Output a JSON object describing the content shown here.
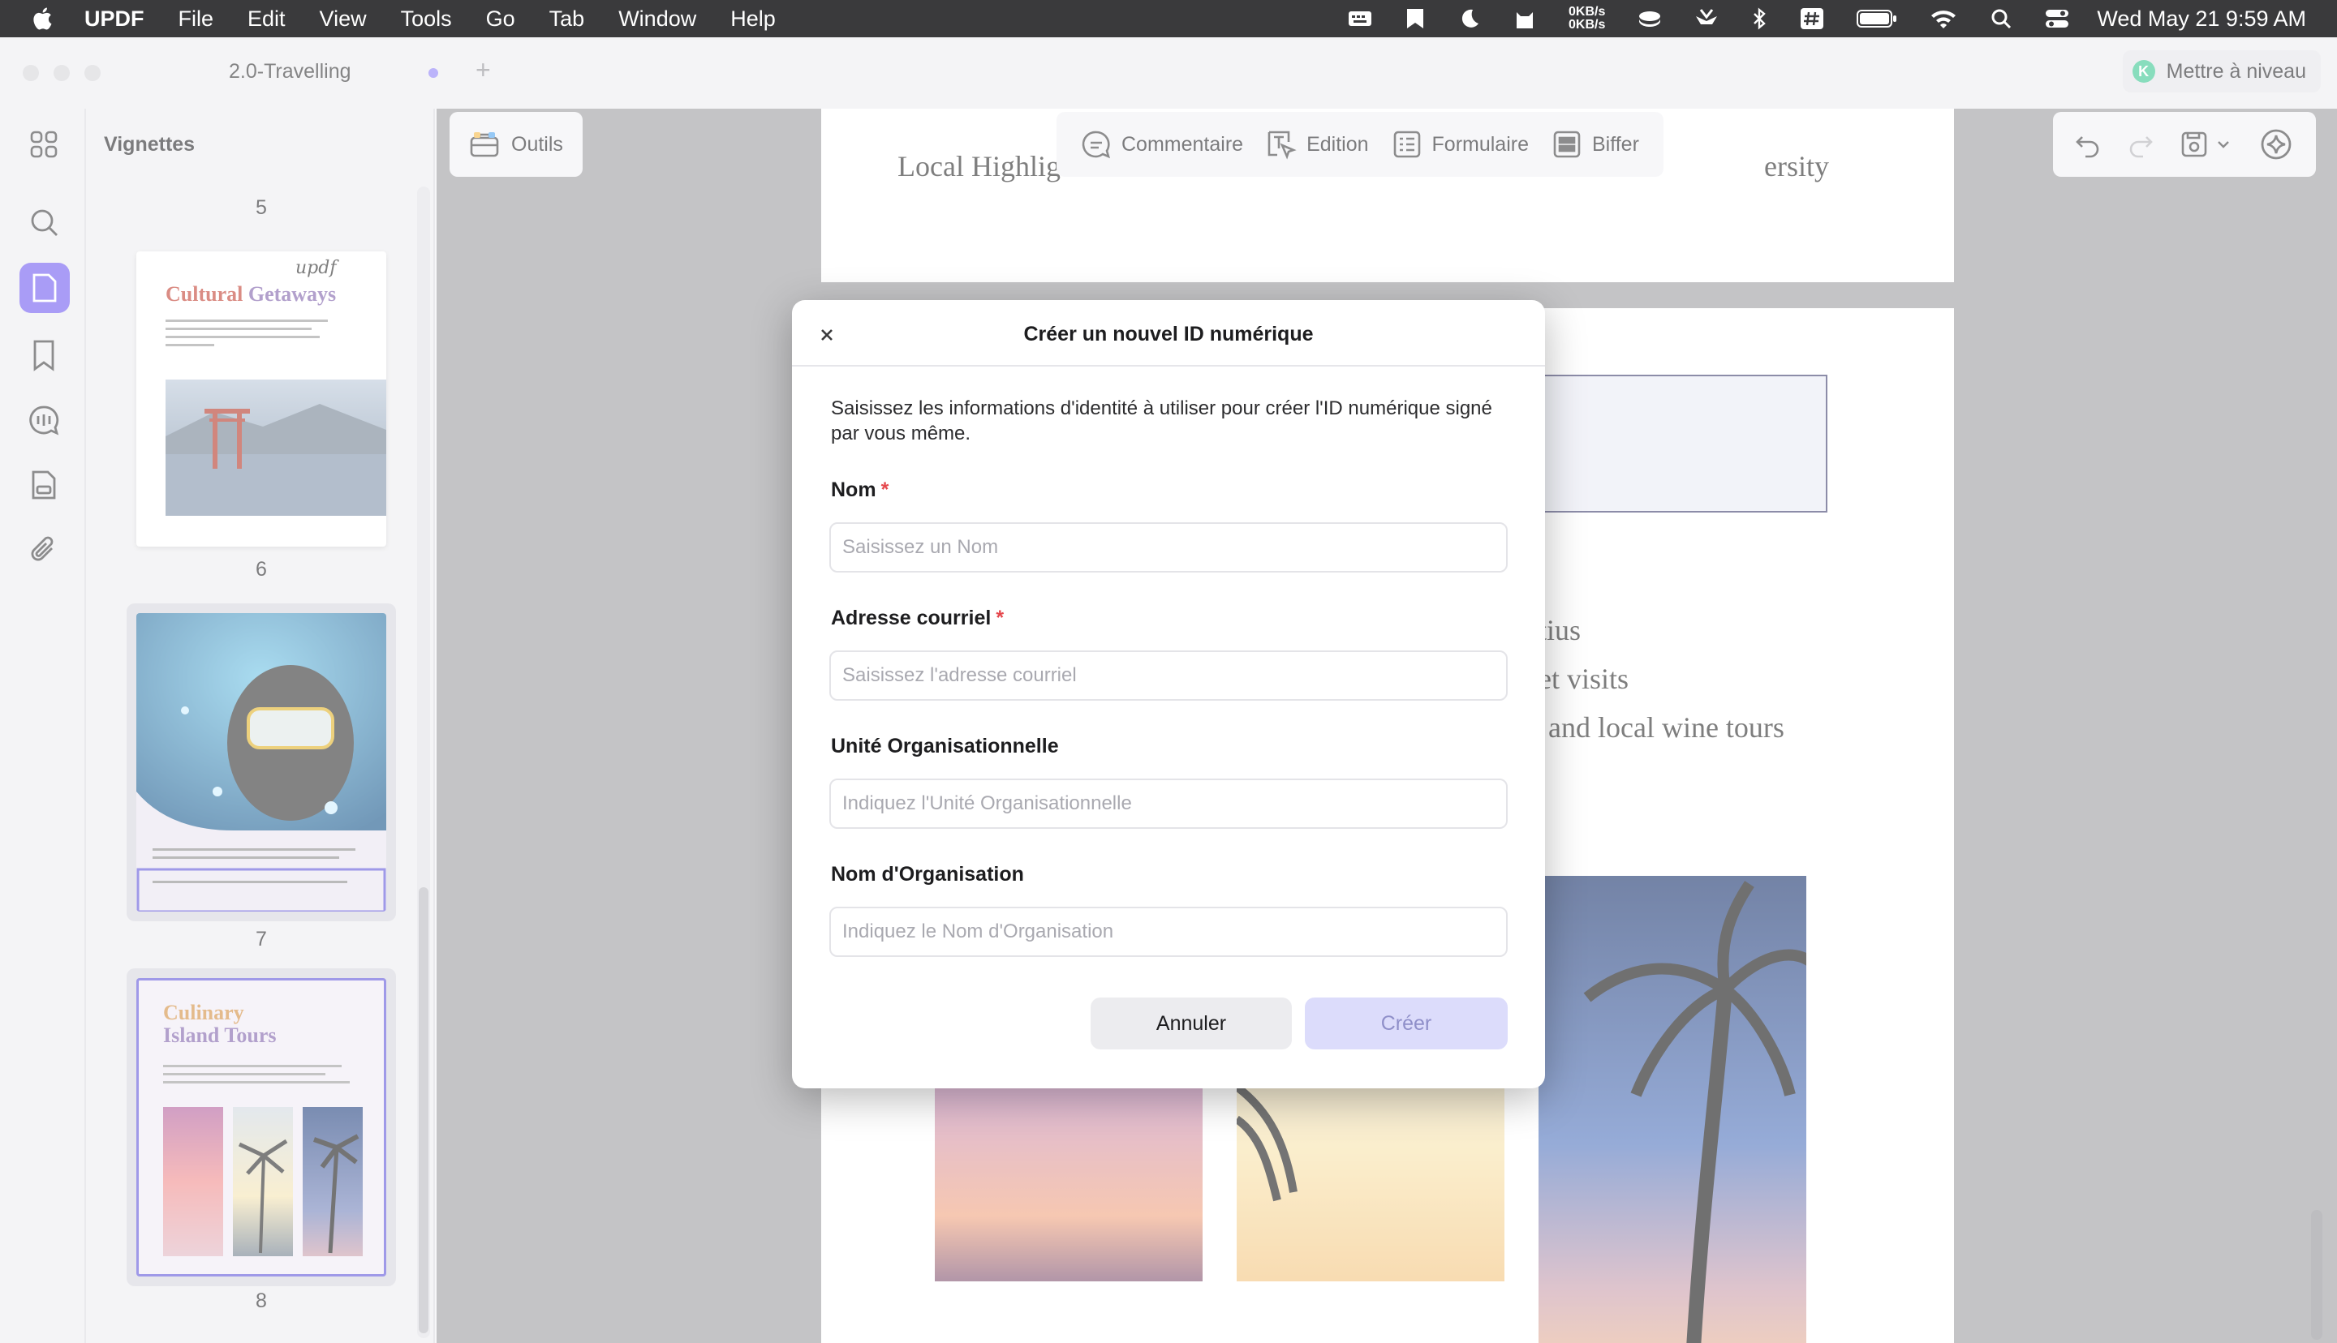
{
  "menubar": {
    "app_name": "UPDF",
    "menus": [
      "File",
      "Edit",
      "View",
      "Tools",
      "Go",
      "Tab",
      "Window",
      "Help"
    ],
    "network_up": "0KB/s",
    "network_down": "0KB/s",
    "datetime": "Wed May 21  9:59 AM"
  },
  "window": {
    "tab_title": "2.0-Travelling",
    "upgrade_label": "Mettre à niveau",
    "upgrade_avatar": "K"
  },
  "sidebar": {
    "heading": "Vignettes",
    "pages": [
      {
        "number": "5"
      },
      {
        "number": "6",
        "title_line1": "Cultural",
        "title_line2": "Getaways",
        "handwriting": "updf"
      },
      {
        "number": "7"
      },
      {
        "number": "8",
        "title_line1": "Culinary",
        "title_line2": "Island Tours"
      }
    ]
  },
  "toolbar": {
    "tools_label": "Outils",
    "comment_label": "Commentaire",
    "edit_label": "Edition",
    "form_label": "Formulaire",
    "redact_label": "Biffer"
  },
  "document": {
    "header_left": "Local Highlig",
    "header_right": "ersity",
    "line1": "tius",
    "line2": "et visits",
    "line3": "and local wine tours"
  },
  "dialog": {
    "title": "Créer un nouvel ID numérique",
    "description": "Saisissez les informations d'identité à utiliser pour créer l'ID numérique signé par vous même.",
    "required_mark": "*",
    "fields": {
      "name": {
        "label": "Nom",
        "placeholder": "Saisissez un Nom",
        "value": ""
      },
      "email": {
        "label": "Adresse courriel",
        "placeholder": "Saisissez l'adresse courriel",
        "value": ""
      },
      "org_unit": {
        "label": "Unité Organisationnelle",
        "placeholder": "Indiquez l'Unité Organisationnelle",
        "value": ""
      },
      "org_name": {
        "label": "Nom d'Organisation",
        "placeholder": "Indiquez le Nom d'Organisation",
        "value": ""
      }
    },
    "cancel_label": "Annuler",
    "create_label": "Créer"
  },
  "colors": {
    "accent": "#6c55f0",
    "required": "#e5484d",
    "create_disabled_bg": "#dcdcfb",
    "upgrade_badge": "#33c48d"
  },
  "icons": [
    "apple-icon",
    "grid-icon",
    "search-icon",
    "pages-icon",
    "bookmark-icon",
    "comment-list-icon",
    "forms-icon",
    "paperclip-icon",
    "toolbox-icon",
    "comment-icon",
    "edit-icon",
    "form-icon",
    "redact-icon",
    "undo-icon",
    "redo-icon",
    "save-icon",
    "ai-icon",
    "close-icon"
  ]
}
